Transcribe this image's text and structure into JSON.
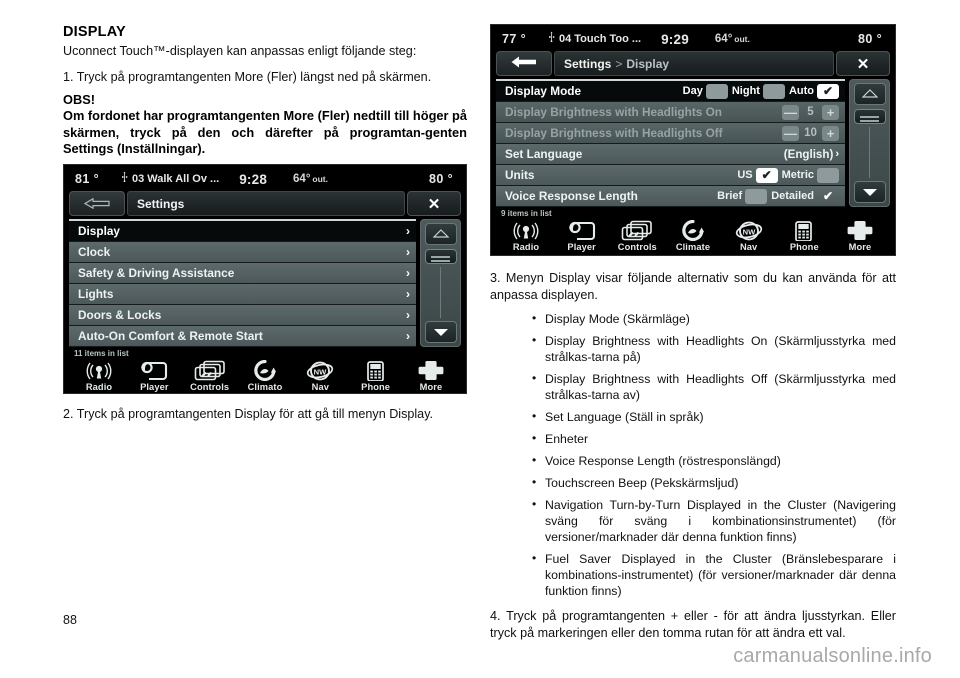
{
  "page": {
    "number": "88",
    "watermark": "carmanualsonline.info"
  },
  "left_column": {
    "heading": "DISPLAY",
    "intro": "Uconnect Touch™-displayen kan anpassas enligt följande steg:",
    "step1": "1. Tryck på programtangenten More (Fler) längst ned på skärmen.",
    "note_heading": "OBS!",
    "note_body": "Om fordonet har programtangenten More (Fler) nedtill till höger på skärmen, tryck på den och därefter på programtan-genten Settings (Inställningar).",
    "step2": "2. Tryck på programtangenten Display för att gå till menyn Display."
  },
  "right_column": {
    "step3": "3. Menyn Display visar följande alternativ som du kan använda för att anpassa displayen.",
    "options": [
      "Display Mode (Skärmläge)",
      "Display Brightness with Headlights On (Skärmljusstyrka med strålkas-tarna på)",
      "Display Brightness with Headlights Off (Skärmljusstyrka med strålkas-tarna av)",
      "Set Language (Ställ in språk)",
      "Enheter",
      "Voice Response Length (röstresponslängd)",
      "Touchscreen Beep (Pekskärmsljud)",
      "Navigation Turn-by-Turn Displayed in the Cluster (Navigering sväng för sväng i kombinationsinstrumentet) (för versioner/marknader där denna funktion finns)",
      "Fuel Saver Displayed in the Cluster (Bränslebesparare i kombinations-instrumentet) (för versioner/marknader där denna funktion finns)"
    ],
    "step4": "4. Tryck på programtangenten + eller - för att ändra ljusstyrkan. Eller tryck på markeringen eller den tomma rutan för att ändra ett val."
  },
  "screenshot_settings": {
    "status": {
      "temp_left": "81 °",
      "track": "03 Walk All Ov ...",
      "usb_icon": "usb-icon",
      "clock": "9:28",
      "outside_temp": "64°",
      "outside_label": "out.",
      "temp_right": "80 °"
    },
    "titlebar": {
      "back_icon": "arrow-left-icon",
      "breadcrumb": "Settings",
      "close_icon": "close-icon"
    },
    "rows": [
      {
        "label": "Display",
        "selected": true,
        "chevron": "›"
      },
      {
        "label": "Clock",
        "selected": false,
        "chevron": "›"
      },
      {
        "label": "Safety & Driving Assistance",
        "selected": false,
        "chevron": "›"
      },
      {
        "label": "Lights",
        "selected": false,
        "chevron": "›"
      },
      {
        "label": "Doors & Locks",
        "selected": false,
        "chevron": "›"
      },
      {
        "label": "Auto-On Comfort & Remote Start",
        "selected": false,
        "chevron": "›"
      }
    ],
    "items_count": "11 items in list",
    "nav": [
      {
        "label": "Radio",
        "icon": "radio-icon"
      },
      {
        "label": "Player",
        "icon": "player-icon"
      },
      {
        "label": "Controls",
        "icon": "controls-icon"
      },
      {
        "label": "Climato",
        "icon": "climate-icon"
      },
      {
        "label": "Nav",
        "icon": "nav-compass-icon"
      },
      {
        "label": "Phone",
        "icon": "phone-icon"
      },
      {
        "label": "More",
        "icon": "plus-icon"
      }
    ],
    "scrollbar": {
      "up_icon": "triangle-up-icon",
      "thumb_icon": "scroll-thumb",
      "down_icon": "triangle-down-icon"
    }
  },
  "screenshot_display": {
    "status": {
      "temp_left": "77 °",
      "track": "04 Touch Too ...",
      "usb_icon": "usb-icon",
      "clock": "9:29",
      "outside_temp": "64°",
      "outside_label": "out.",
      "temp_right": "80 °"
    },
    "titlebar": {
      "back_icon": "arrow-left-icon",
      "breadcrumb_root": "Settings",
      "breadcrumb_sep": ">",
      "breadcrumb_leaf": "Display",
      "close_icon": "close-icon"
    },
    "rows": {
      "display_mode": {
        "label": "Display Mode",
        "options": [
          {
            "label": "Day",
            "checked": false
          },
          {
            "label": "Night",
            "checked": false
          },
          {
            "label": "Auto",
            "checked": true
          }
        ]
      },
      "brightness_on": {
        "label": "Display Brightness with Headlights On",
        "minus": "—",
        "value": "5",
        "plus": "+"
      },
      "brightness_off": {
        "label": "Display Brightness with Headlights Off",
        "minus": "—",
        "value": "10",
        "plus": "+"
      },
      "set_language": {
        "label": "Set Language",
        "value": "(English)",
        "chevron": "›"
      },
      "units": {
        "label": "Units",
        "options": [
          {
            "label": "US",
            "checked": true
          },
          {
            "label": "Metric",
            "checked": false
          }
        ]
      },
      "voice_response": {
        "label": "Voice Response Length",
        "options": [
          {
            "label": "Brief",
            "checked": false
          },
          {
            "label": "Detailed",
            "checked": true
          }
        ]
      }
    },
    "items_count": "9 items in list",
    "nav": [
      {
        "label": "Radio",
        "icon": "radio-icon"
      },
      {
        "label": "Player",
        "icon": "player-icon"
      },
      {
        "label": "Controls",
        "icon": "controls-icon"
      },
      {
        "label": "Climate",
        "icon": "climate-icon"
      },
      {
        "label": "Nav",
        "icon": "nav-compass-icon"
      },
      {
        "label": "Phone",
        "icon": "phone-icon"
      },
      {
        "label": "More",
        "icon": "plus-icon"
      }
    ],
    "scrollbar": {
      "up_icon": "triangle-up-icon",
      "thumb_icon": "scroll-thumb",
      "down_icon": "triangle-down-icon"
    }
  }
}
